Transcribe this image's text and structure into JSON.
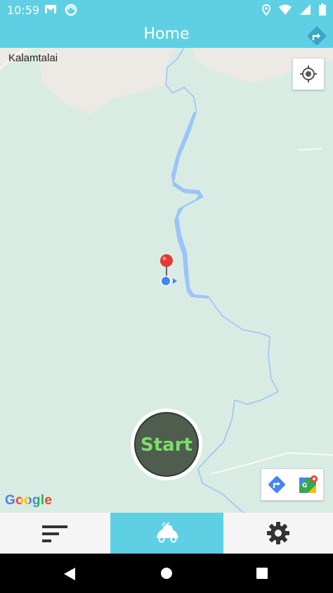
{
  "status_bar": {
    "time": "10:59",
    "left_icons": [
      "gmail-icon",
      "sync-icon"
    ],
    "right_icons": [
      "location-icon",
      "wifi-icon",
      "signal-icon",
      "battery-icon"
    ]
  },
  "app_bar": {
    "title": "Home",
    "route_icon": "route-diamond-icon",
    "color": "#5fd0e3"
  },
  "map": {
    "place_label": "Kalamtalai",
    "attribution": "Google",
    "controls": [
      "my-location-icon",
      "directions-icon",
      "google-maps-icon"
    ],
    "colors": {
      "land": "#d9ece3",
      "built": "#ede9e5",
      "water": "#9cc4f8"
    }
  },
  "start_button": {
    "label": "Start",
    "label_color": "#7ddc6c",
    "fill_color": "#4e5d4e"
  },
  "bottom_nav": {
    "items": [
      {
        "name": "list",
        "icon": "sort-list-icon",
        "active": false
      },
      {
        "name": "drive",
        "icon": "car-icon",
        "active": true
      },
      {
        "name": "settings",
        "icon": "gear-icon",
        "active": false
      }
    ]
  },
  "system_nav": [
    "back-icon",
    "home-icon",
    "recents-icon"
  ]
}
